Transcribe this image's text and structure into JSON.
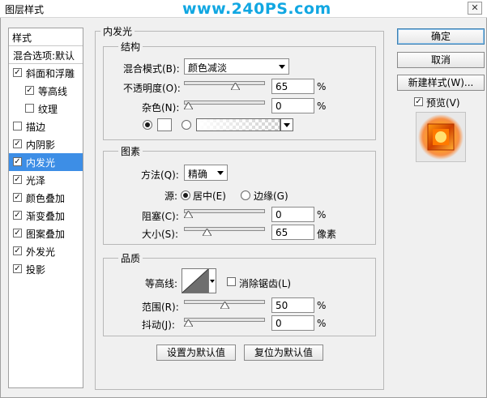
{
  "window": {
    "title": "图层样式",
    "watermark": "www.240PS.com",
    "close_glyph": "✕"
  },
  "style_list": {
    "header": "样式",
    "blending": "混合选项:默认",
    "items": [
      {
        "label": "斜面和浮雕",
        "checked": true
      },
      {
        "label": "等高线",
        "checked": true
      },
      {
        "label": "纹理",
        "checked": false
      },
      {
        "label": "描边",
        "checked": false
      },
      {
        "label": "内阴影",
        "checked": true
      },
      {
        "label": "内发光",
        "checked": true
      },
      {
        "label": "光泽",
        "checked": true
      },
      {
        "label": "颜色叠加",
        "checked": true
      },
      {
        "label": "渐变叠加",
        "checked": true
      },
      {
        "label": "图案叠加",
        "checked": true
      },
      {
        "label": "外发光",
        "checked": true
      },
      {
        "label": "投影",
        "checked": true
      }
    ],
    "selected_index": 5
  },
  "panel": {
    "title": "内发光",
    "structure": {
      "title": "结构",
      "blend_mode_label": "混合模式(B):",
      "blend_mode_value": "颜色减淡",
      "opacity_label": "不透明度(O):",
      "opacity_value": "65",
      "opacity_level": 0.65,
      "noise_label": "杂色(N):",
      "noise_value": "0",
      "noise_level": 0,
      "percent": "%",
      "color_selected": "solid",
      "swatch_color": "#ffffff"
    },
    "elements": {
      "title": "图素",
      "method_label": "方法(Q):",
      "method_value": "精确",
      "source_label": "源:",
      "source_center": "居中(E)",
      "source_edge": "边缘(G)",
      "source_selected": "center",
      "choke_label": "阻塞(C):",
      "choke_value": "0",
      "choke_level": 0,
      "size_label": "大小(S):",
      "size_value": "65",
      "size_level": 0.26,
      "percent": "%",
      "pixels": "像素"
    },
    "quality": {
      "title": "品质",
      "contour_label": "等高线:",
      "antialias_label": "消除锯齿(L)",
      "antialias_checked": false,
      "range_label": "范围(R):",
      "range_value": "50",
      "range_level": 0.5,
      "jitter_label": "抖动(J):",
      "jitter_value": "0",
      "jitter_level": 0,
      "percent": "%"
    },
    "buttons": {
      "set_default": "设置为默认值",
      "reset_default": "复位为默认值"
    }
  },
  "right": {
    "ok": "确定",
    "cancel": "取消",
    "new_style": "新建样式(W)...",
    "preview_label": "预览(V)",
    "preview_checked": true
  },
  "colors": {
    "selection": "#3d8ee6",
    "watermark": "#11a7e2",
    "preview_glow": "#ff7a00"
  }
}
